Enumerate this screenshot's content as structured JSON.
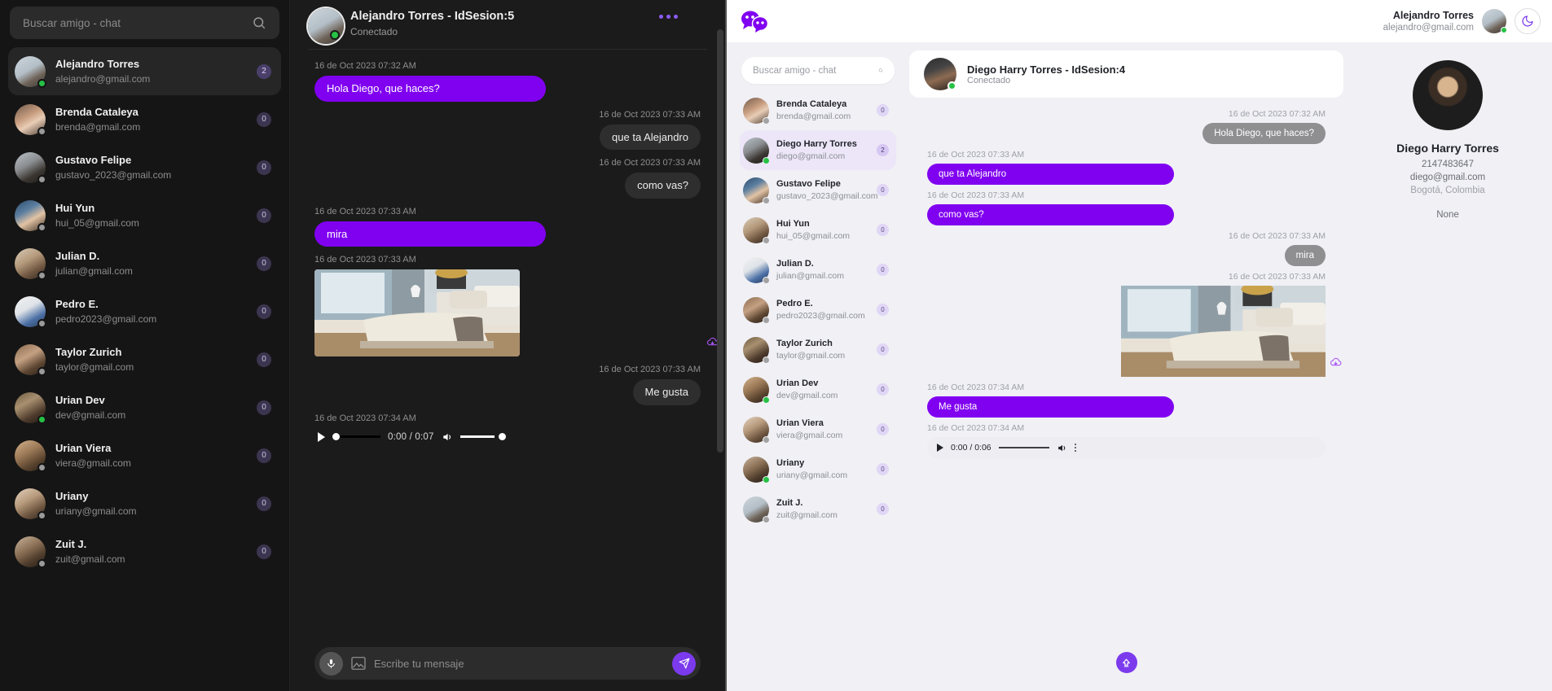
{
  "dark_app": {
    "search": {
      "placeholder": "Buscar amigo - chat",
      "value": "",
      "icon": "search-icon"
    },
    "contacts": [
      {
        "name": "Alejandro Torres",
        "email": "alejandro@gmail.com",
        "badge": "2",
        "status": "online",
        "active": true
      },
      {
        "name": "Brenda Cataleya",
        "email": "brenda@gmail.com",
        "badge": "0",
        "status": "offline",
        "active": false
      },
      {
        "name": "Gustavo Felipe",
        "email": "gustavo_2023@gmail.com",
        "badge": "0",
        "status": "offline",
        "active": false
      },
      {
        "name": "Hui Yun",
        "email": "hui_05@gmail.com",
        "badge": "0",
        "status": "offline",
        "active": false
      },
      {
        "name": "Julian D.",
        "email": "julian@gmail.com",
        "badge": "0",
        "status": "offline",
        "active": false
      },
      {
        "name": "Pedro E.",
        "email": "pedro2023@gmail.com",
        "badge": "0",
        "status": "offline",
        "active": false
      },
      {
        "name": "Taylor Zurich",
        "email": "taylor@gmail.com",
        "badge": "0",
        "status": "offline",
        "active": false
      },
      {
        "name": "Urian Dev",
        "email": "dev@gmail.com",
        "badge": "0",
        "status": "online",
        "active": false
      },
      {
        "name": "Urian Viera",
        "email": "viera@gmail.com",
        "badge": "0",
        "status": "offline",
        "active": false
      },
      {
        "name": "Uriany",
        "email": "uriany@gmail.com",
        "badge": "0",
        "status": "offline",
        "active": false
      },
      {
        "name": "Zuit J.",
        "email": "zuit@gmail.com",
        "badge": "0",
        "status": "offline",
        "active": false
      }
    ],
    "chat_header": {
      "title": "Alejandro Torres - IdSesion:5",
      "status": "Conectado",
      "menu_icon": "more-options-icon"
    },
    "messages": [
      {
        "time": "16 de Oct 2023 07:32 AM",
        "text": "Hola Diego, que haces?",
        "side": "left",
        "type": "text"
      },
      {
        "time": "16 de Oct 2023 07:33 AM",
        "text": "que ta Alejandro",
        "side": "right",
        "type": "text"
      },
      {
        "time": "16 de Oct 2023 07:33 AM",
        "text": "como vas?",
        "side": "right",
        "type": "text"
      },
      {
        "time": "16 de Oct 2023 07:33 AM",
        "text": "mira",
        "side": "left",
        "type": "text"
      },
      {
        "time": "16 de Oct 2023 07:33 AM",
        "text": "",
        "side": "left",
        "type": "image"
      },
      {
        "time": "16 de Oct 2023 07:33 AM",
        "text": "Me gusta",
        "side": "right",
        "type": "text"
      },
      {
        "time": "16 de Oct 2023 07:34 AM",
        "text": "",
        "side": "left",
        "type": "audio"
      }
    ],
    "audio": {
      "time": "0:00 / 0:07",
      "play_icon": "play-icon",
      "volume_icon": "volume-icon"
    },
    "composer": {
      "placeholder": "Escribe tu mensaje",
      "value": "",
      "mic_icon": "microphone-icon",
      "image_icon": "image-attachment-icon",
      "send_icon": "send-icon"
    }
  },
  "light_app": {
    "logo": "chat-bubbles-logo",
    "account": {
      "name": "Alejandro Torres",
      "email": "alejandro@gmail.com",
      "status": "online"
    },
    "theme_toggle": {
      "icon": "moon-icon",
      "label": "dark-mode-toggle"
    },
    "search": {
      "placeholder": "Buscar amigo - chat",
      "value": "",
      "icon": "search-icon"
    },
    "contacts": [
      {
        "name": "Brenda Cataleya",
        "email": "brenda@gmail.com",
        "badge": "0",
        "status": "offline",
        "active": false
      },
      {
        "name": "Diego Harry Torres",
        "email": "diego@gmail.com",
        "badge": "2",
        "status": "online",
        "active": true
      },
      {
        "name": "Gustavo Felipe",
        "email": "gustavo_2023@gmail.com",
        "badge": "0",
        "status": "offline",
        "active": false
      },
      {
        "name": "Hui Yun",
        "email": "hui_05@gmail.com",
        "badge": "0",
        "status": "offline",
        "active": false
      },
      {
        "name": "Julian D.",
        "email": "julian@gmail.com",
        "badge": "0",
        "status": "offline",
        "active": false
      },
      {
        "name": "Pedro E.",
        "email": "pedro2023@gmail.com",
        "badge": "0",
        "status": "offline",
        "active": false
      },
      {
        "name": "Taylor Zurich",
        "email": "taylor@gmail.com",
        "badge": "0",
        "status": "offline",
        "active": false
      },
      {
        "name": "Urian Dev",
        "email": "dev@gmail.com",
        "badge": "0",
        "status": "online",
        "active": false
      },
      {
        "name": "Urian Viera",
        "email": "viera@gmail.com",
        "badge": "0",
        "status": "offline",
        "active": false
      },
      {
        "name": "Uriany",
        "email": "uriany@gmail.com",
        "badge": "0",
        "status": "online",
        "active": false
      },
      {
        "name": "Zuit J.",
        "email": "zuit@gmail.com",
        "badge": "0",
        "status": "offline",
        "active": false
      }
    ],
    "chat_header": {
      "title": "Diego Harry Torres - IdSesion:4",
      "status": "Conectado"
    },
    "messages": [
      {
        "time": "16 de Oct 2023 07:32 AM",
        "text": "Hola Diego, que haces?",
        "side": "right",
        "type": "text"
      },
      {
        "time": "16 de Oct 2023 07:33 AM",
        "text": "que ta Alejandro",
        "side": "left",
        "type": "text"
      },
      {
        "time": "16 de Oct 2023 07:33 AM",
        "text": "como vas?",
        "side": "left",
        "type": "text"
      },
      {
        "time": "16 de Oct 2023 07:33 AM",
        "text": "mira",
        "side": "right",
        "type": "text"
      },
      {
        "time": "16 de Oct 2023 07:33 AM",
        "text": "",
        "side": "right",
        "type": "image"
      },
      {
        "time": "16 de Oct 2023 07:34 AM",
        "text": "Me gusta",
        "side": "left",
        "type": "text"
      },
      {
        "time": "16 de Oct 2023 07:34 AM",
        "text": "",
        "side": "left",
        "type": "audio"
      }
    ],
    "audio": {
      "time": "0:00 / 0:06",
      "play_icon": "play-icon",
      "volume_icon": "volume-icon",
      "menu_icon": "kebab-menu-icon"
    },
    "scroll_fab": {
      "icon": "scroll-up-icon"
    },
    "profile": {
      "name": "Diego Harry Torres",
      "phone": "2147483647",
      "email": "diego@gmail.com",
      "location": "Bogotá, Colombia",
      "extra": "None"
    }
  },
  "colors": {
    "accent_purple": "#8000f0",
    "accent_violet": "#7c3aed",
    "online_green": "#26c145",
    "offline_gray": "#9a9a9a",
    "dark_bg": "#151515",
    "light_bg": "#f0f0f5"
  }
}
